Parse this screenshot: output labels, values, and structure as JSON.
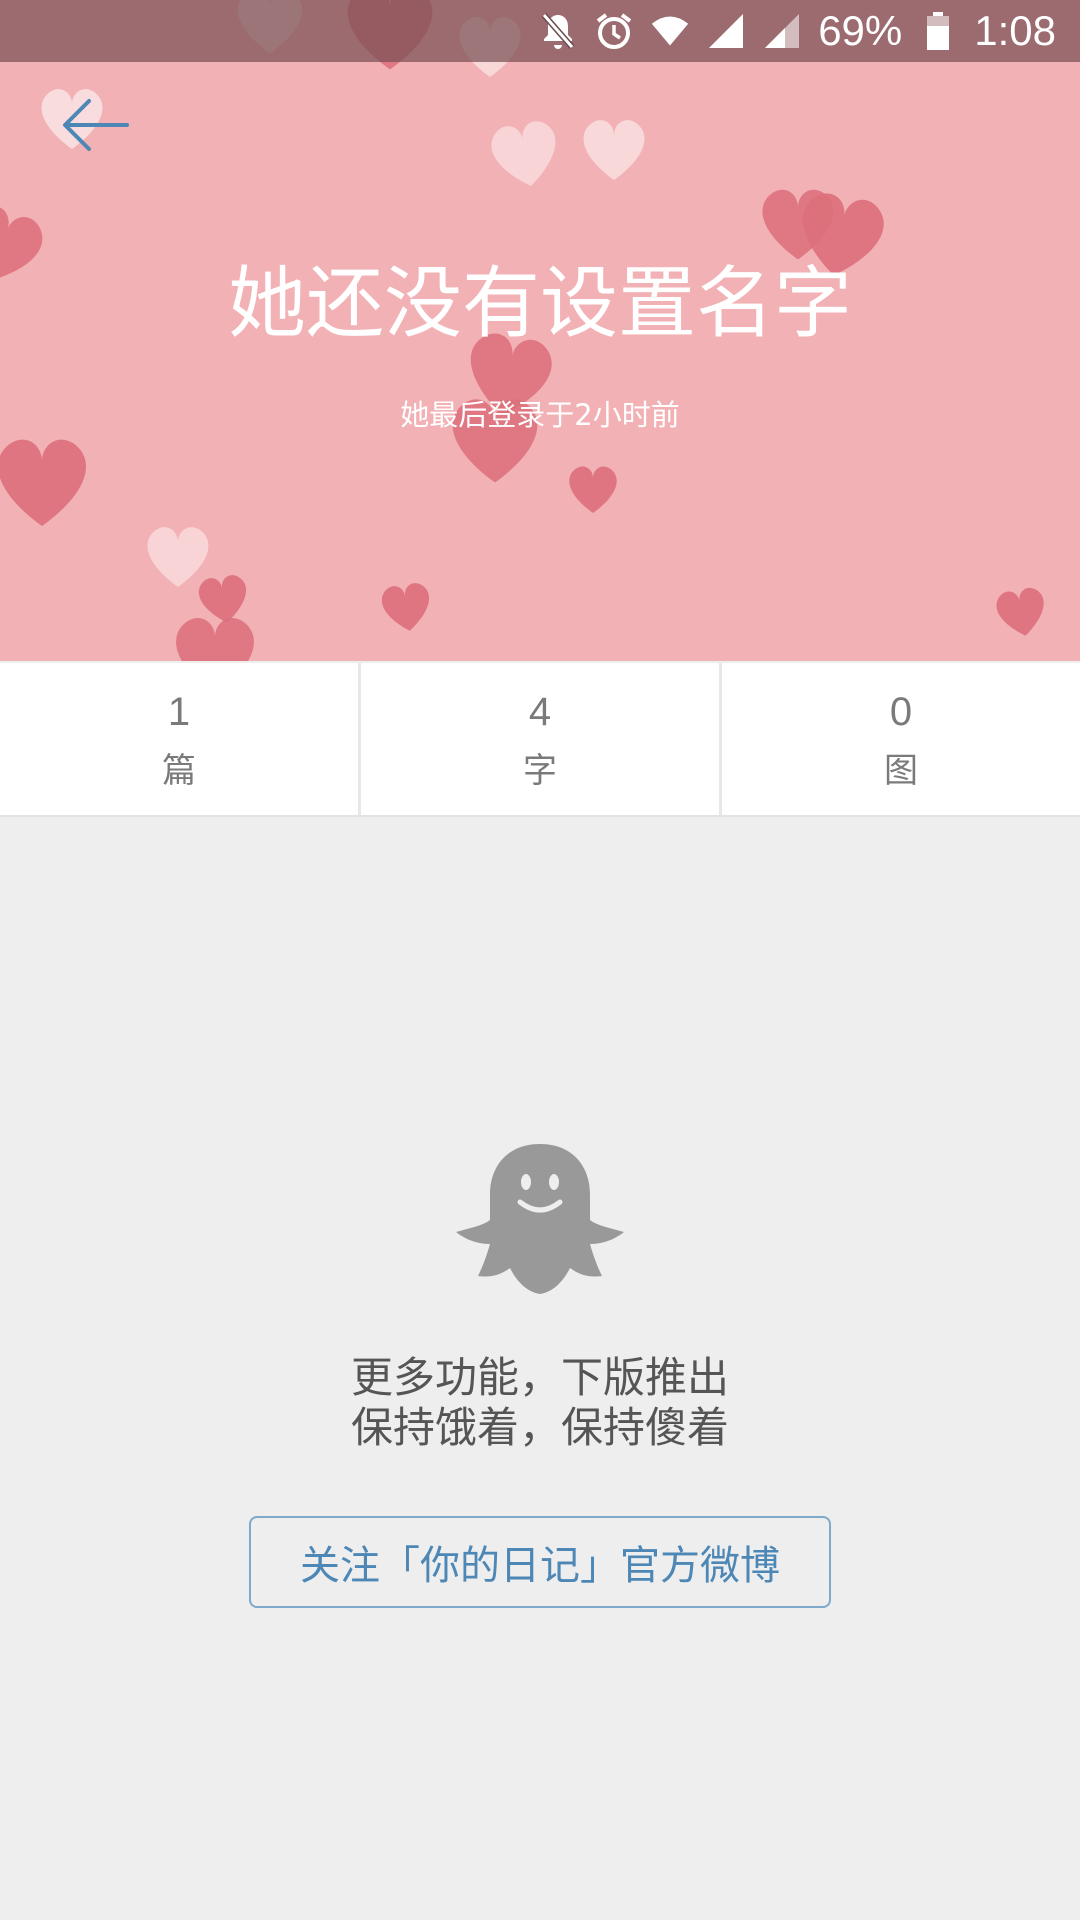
{
  "status_bar": {
    "battery": "69%",
    "time": "1:08",
    "icons": [
      "notifications-off-icon",
      "alarm-icon",
      "wifi-icon",
      "signal-icon",
      "signal-icon",
      "battery-icon"
    ]
  },
  "header": {
    "name": "她还没有设置名字",
    "last_login": "她最后登录于2小时前",
    "background_color": "#f2b1b5"
  },
  "stats": [
    {
      "value": "1",
      "label": "篇"
    },
    {
      "value": "4",
      "label": "字"
    },
    {
      "value": "0",
      "label": "图"
    }
  ],
  "empty_state": {
    "icon": "ghost-icon",
    "line1": "更多功能，下版推出",
    "line2": "保持饿着，保持傻着",
    "follow_button": "关注「你的日记」官方微博"
  },
  "colors": {
    "accent": "#4d87b6",
    "heart": "#dc6f7a"
  }
}
